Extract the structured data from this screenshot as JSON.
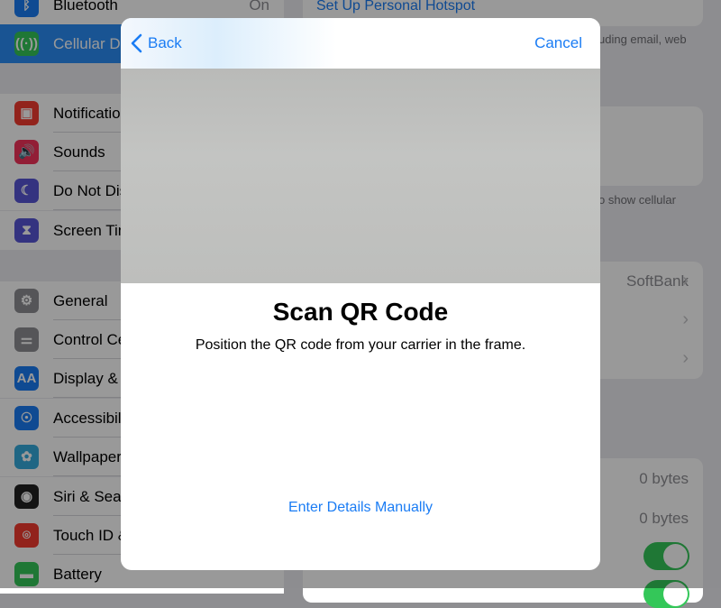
{
  "sidebar": {
    "items": [
      {
        "label": "Bluetooth",
        "value": "On",
        "icon": "bluetooth-icon",
        "color": "#1a7cf4"
      },
      {
        "label": "Cellular Da",
        "icon": "cellular-antenna-icon",
        "color": "#34c759",
        "selected": true
      },
      {
        "label": "Notificatio",
        "icon": "notifications-icon",
        "color": "#f33b30"
      },
      {
        "label": "Sounds",
        "icon": "speaker-icon",
        "color": "#f3325a"
      },
      {
        "label": "Do Not Dis",
        "icon": "moon-icon",
        "color": "#5856d6"
      },
      {
        "label": "Screen Tim",
        "icon": "hourglass-icon",
        "color": "#5856d6"
      },
      {
        "label": "General",
        "icon": "gear-icon",
        "color": "#8e8e93"
      },
      {
        "label": "Control Ce",
        "icon": "switches-icon",
        "color": "#8e8e93"
      },
      {
        "label": "Display &",
        "icon": "text-size-icon",
        "color": "#1a7cf4"
      },
      {
        "label": "Accessibil",
        "icon": "accessibility-icon",
        "color": "#1a7cf4"
      },
      {
        "label": "Wallpaper",
        "icon": "flower-icon",
        "color": "#35aadc"
      },
      {
        "label": "Siri & Sear",
        "icon": "siri-icon",
        "color": "#222"
      },
      {
        "label": "Touch ID &",
        "icon": "fingerprint-icon",
        "color": "#f33b30"
      },
      {
        "label": "Battery",
        "icon": "battery-icon",
        "color": "#34c759"
      }
    ]
  },
  "detail": {
    "hotspot_link": "Set Up Personal Hotspot",
    "note_top": "uding email, web",
    "note_mid": "o show cellular",
    "carrier": "SoftBank",
    "usage1": "0 bytes",
    "usage2": "0 bytes"
  },
  "modal": {
    "back_label": "Back",
    "cancel_label": "Cancel",
    "title": "Scan QR Code",
    "subtitle": "Position the QR code from your carrier in the frame.",
    "manual_label": "Enter Details Manually"
  }
}
